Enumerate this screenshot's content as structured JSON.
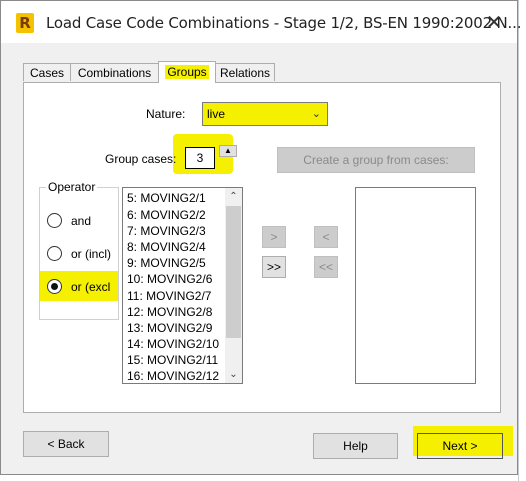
{
  "window": {
    "title": "Load Case Code Combinations - Stage 1/2, BS-EN 1990:2002 N...",
    "close_glyph": "✕"
  },
  "tabs": [
    {
      "label": "Cases",
      "active": false
    },
    {
      "label": "Combinations",
      "active": false
    },
    {
      "label": "Groups",
      "active": true
    },
    {
      "label": "Relations",
      "active": false
    }
  ],
  "groups": {
    "nature_label": "Nature:",
    "nature_value": "live",
    "group_cases_label": "Group cases:",
    "group_cases_value": "3",
    "create_group_label": "Create a group from cases:",
    "operator": {
      "title": "Operator",
      "options": [
        {
          "label": "and",
          "checked": false
        },
        {
          "label": "or (incl)",
          "checked": false
        },
        {
          "label": "or (excl",
          "checked": true
        }
      ]
    },
    "cases_list": [
      "5: MOVING2/1",
      "6: MOVING2/2",
      "7: MOVING2/3",
      "8: MOVING2/4",
      "9: MOVING2/5",
      "10: MOVING2/6",
      "11: MOVING2/7",
      "12: MOVING2/8",
      "13: MOVING2/9",
      "14: MOVING2/10",
      "15: MOVING2/11",
      "16: MOVING2/12"
    ],
    "move_buttons": {
      "add_one": ">",
      "add_all": ">>",
      "remove_one": "<",
      "remove_all": "<<"
    }
  },
  "footer": {
    "back_label": "< Back",
    "help_label": "Help",
    "next_label": "Next >"
  },
  "colors": {
    "highlight": "#f4f000",
    "dialog_bg": "#f0f0f0",
    "app_icon": "#f5c200"
  },
  "icons": {
    "app": "robot-app-icon",
    "dropdown": "chevron-down-icon",
    "spin_up": "triangle-up-icon"
  }
}
